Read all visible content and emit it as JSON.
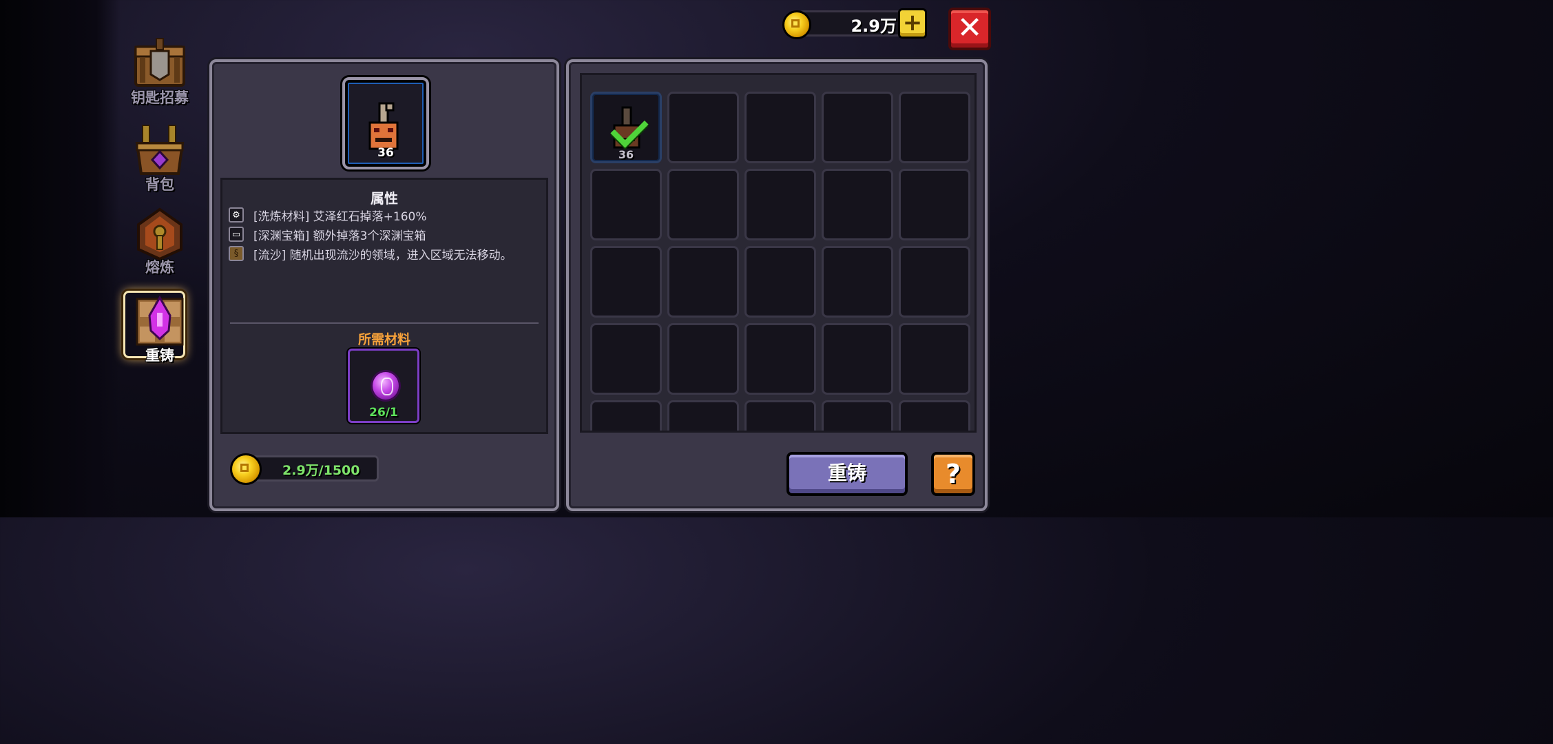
{
  "sidebar": {
    "items": [
      {
        "label": "钥匙招募",
        "icon": "chest-banner-icon"
      },
      {
        "label": "背包",
        "icon": "backpack-icon"
      },
      {
        "label": "熔炼",
        "icon": "smelt-key-icon"
      },
      {
        "label": "重铸",
        "icon": "reforge-gem-icon",
        "active": true
      }
    ]
  },
  "topbar": {
    "gold_amount": "2.9万",
    "plus_label": "+",
    "close_label": "✕"
  },
  "item": {
    "count": "36"
  },
  "attributes": {
    "title": "属性",
    "lines": [
      {
        "icon": "gear-icon",
        "text": "[洗炼材料] 艾泽红石掉落+160%"
      },
      {
        "icon": "chest-icon",
        "text": "[深渊宝箱] 额外掉落3个深渊宝箱"
      },
      {
        "icon": "quicksand-icon",
        "text": "[流沙] 随机出现流沙的领域，进入区域无法移动。"
      }
    ]
  },
  "materials": {
    "title": "所需材料",
    "count": "26/1"
  },
  "cost": {
    "amount": "2.9万/1500"
  },
  "inventory": {
    "slots": [
      {
        "count": "36",
        "selected": true
      }
    ]
  },
  "buttons": {
    "reforge_label": "重铸",
    "help_label": "?"
  },
  "colors": {
    "accent_orange": "#f7a23a",
    "count_green": "#5de05a",
    "close_red": "#d9262a",
    "reforge_purple": "#7a72b8"
  }
}
